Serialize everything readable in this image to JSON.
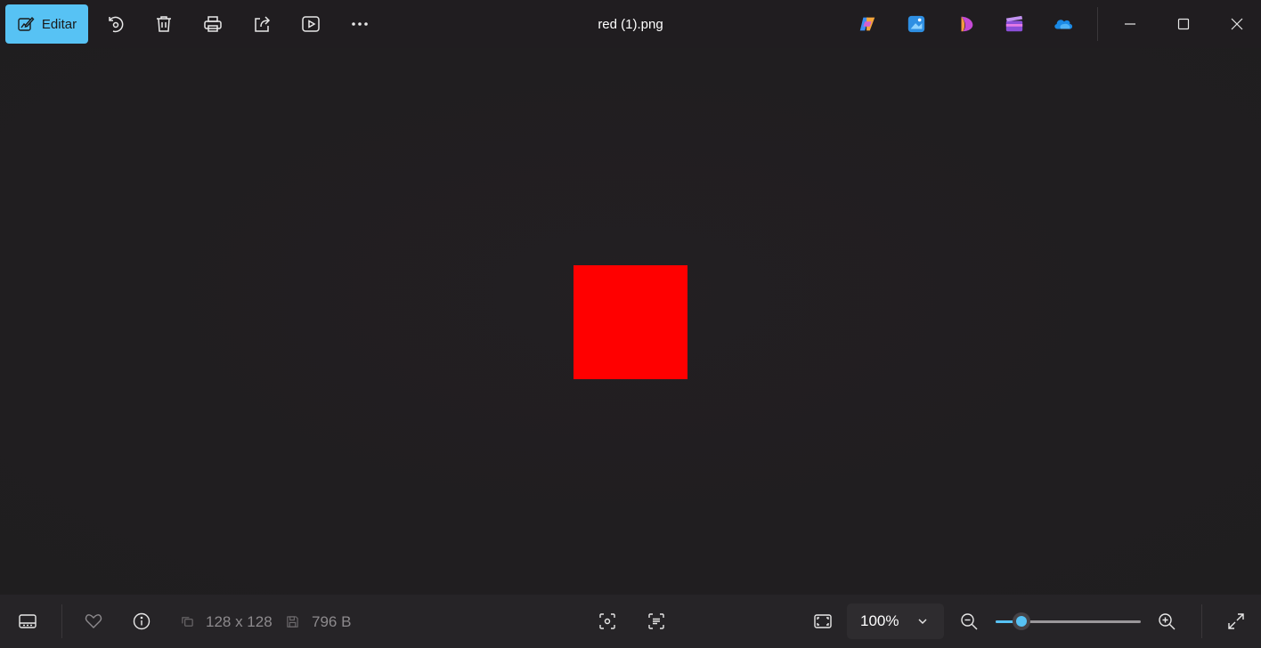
{
  "toolbar": {
    "edit_label": "Editar",
    "icons": [
      "rotate-icon",
      "delete-icon",
      "print-icon",
      "share-icon",
      "slideshow-icon",
      "more-icon"
    ]
  },
  "window": {
    "title": "red (1).png"
  },
  "apps": [
    "copilot-app-icon",
    "image-creator-app-icon",
    "designer-app-icon",
    "clipchamp-app-icon",
    "onedrive-app-icon"
  ],
  "image": {
    "color": "#ff0000"
  },
  "status": {
    "dimensions": "128 x 128",
    "file_size": "796 B"
  },
  "zoom": {
    "value": "100%",
    "slider_level": 0.18
  },
  "colors": {
    "accent": "#57c2f4",
    "background": "#201d20"
  }
}
